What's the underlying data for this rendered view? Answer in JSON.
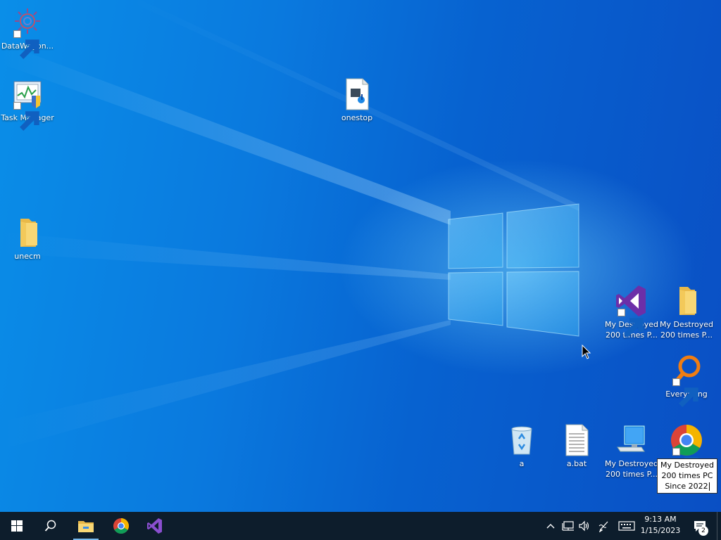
{
  "desktop_icons": {
    "datawagon": {
      "label": "DataWagon...",
      "icon": "datawagon-gear-icon"
    },
    "task_manager": {
      "label": "Task Manager",
      "icon": "task-manager-icon"
    },
    "onestop": {
      "label": "onestop",
      "icon": "media-file-icon"
    },
    "unecm": {
      "label": "unecm",
      "icon": "folder-icon"
    },
    "vs_shortcut": {
      "label": "My Destroyed 200 times P...",
      "icon": "visual-studio-icon"
    },
    "folder_shortcut": {
      "label": "My Destroyed 200 times P...",
      "icon": "folder-icon"
    },
    "everything": {
      "label": "Everything",
      "icon": "everything-search-icon"
    },
    "recycle": {
      "label": "a",
      "icon": "recycle-bin-icon"
    },
    "abat": {
      "label": "a.bat",
      "icon": "text-file-icon"
    },
    "pc_shortcut": {
      "label": "My Destroyed 200 times P...",
      "icon": "computer-icon"
    },
    "chrome_shortcut": {
      "label": "My Destroyed 200 times PC Since 2022",
      "icon": "chrome-icon",
      "renaming": true
    }
  },
  "taskbar": {
    "start": {
      "icon": "windows-start-icon"
    },
    "search": {
      "icon": "search-icon"
    },
    "pinned": [
      {
        "name": "File Explorer",
        "icon": "file-explorer-icon",
        "active": true
      },
      {
        "name": "Google Chrome",
        "icon": "chrome-icon",
        "active": false
      },
      {
        "name": "Visual Studio",
        "icon": "visual-studio-icon",
        "active": false
      }
    ],
    "tray": {
      "time": "9:13 AM",
      "date": "1/15/2023",
      "notification_count": "2"
    }
  },
  "colors": {
    "desktop_blue": "#0a79de",
    "taskbar": "#0d1d2c",
    "vs_purple": "#6c2fa8",
    "folder_yellow": "#f8d775"
  }
}
